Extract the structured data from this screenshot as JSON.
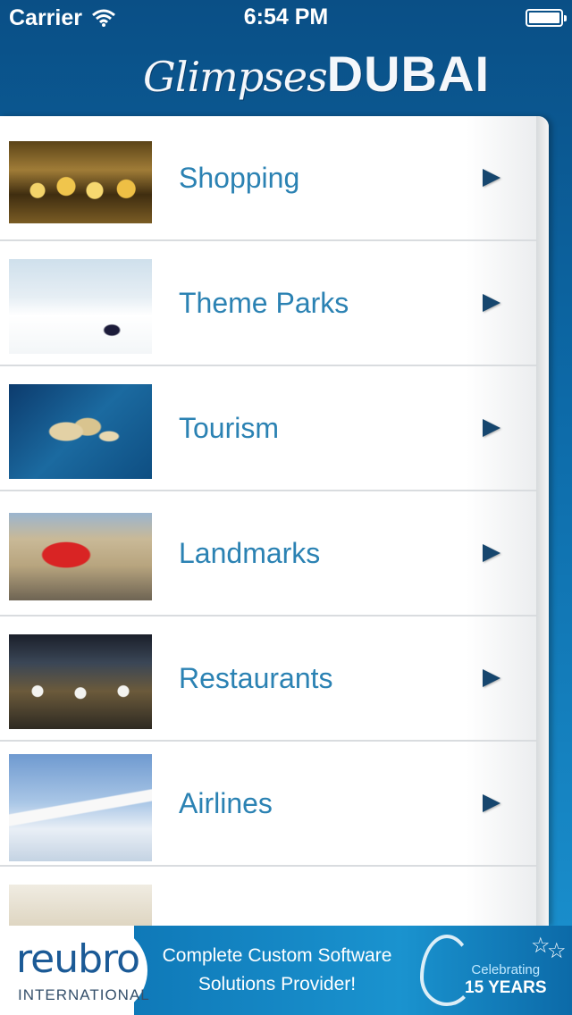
{
  "status_bar": {
    "carrier": "Carrier",
    "time": "6:54 PM",
    "battery_level": 1.0
  },
  "header": {
    "logo_script": "Glimpses",
    "logo_bold": "DUBAI"
  },
  "menu": {
    "items": [
      {
        "label": "Shopping",
        "thumbnail": "gold jewellery shop"
      },
      {
        "label": "Theme Parks",
        "thumbnail": "indoor ski slope"
      },
      {
        "label": "Tourism",
        "thumbnail": "palm island aerial"
      },
      {
        "label": "Landmarks",
        "thumbnail": "red roofed theme park"
      },
      {
        "label": "Restaurants",
        "thumbnail": "dining hall"
      },
      {
        "label": "Airlines",
        "thumbnail": "airliner above clouds"
      },
      {
        "label": "",
        "thumbnail": "partially visible"
      }
    ],
    "chevron_icon": "disclosure-arrow-icon",
    "label_color": "#2b82b3"
  },
  "ad": {
    "brand": "reubro",
    "brand_sub": "INTERNATIONAL",
    "line1": "Complete Custom Software",
    "line2": "Solutions Provider!",
    "badge_top": "Celebrating",
    "badge_bottom": "15 YEARS"
  },
  "colors": {
    "header_blue": "#0a4f86",
    "accent_blue": "#1a93cf"
  }
}
